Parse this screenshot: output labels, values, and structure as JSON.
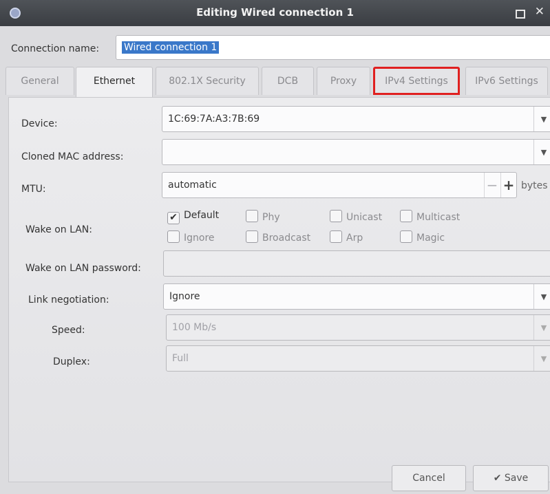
{
  "window": {
    "title": "Editing Wired connection 1",
    "close_glyph": "✕"
  },
  "connection_name": {
    "label": "Connection name:",
    "value": "Wired connection 1"
  },
  "tabs": [
    {
      "label": "General",
      "active": false
    },
    {
      "label": "Ethernet",
      "active": true
    },
    {
      "label": "802.1X Security",
      "active": false
    },
    {
      "label": "DCB",
      "active": false
    },
    {
      "label": "Proxy",
      "active": false
    },
    {
      "label": "IPv4 Settings",
      "active": false,
      "highlighted": true
    },
    {
      "label": "IPv6 Settings",
      "active": false
    }
  ],
  "ethernet": {
    "device": {
      "label": "Device:",
      "value": "1C:69:7A:A3:7B:69"
    },
    "cloned_mac": {
      "label": "Cloned MAC address:",
      "value": ""
    },
    "mtu": {
      "label": "MTU:",
      "value": "automatic",
      "unit": "bytes",
      "minus": "−",
      "plus": "+"
    },
    "wake_on_lan": {
      "label": "Wake on LAN:",
      "options": [
        {
          "label": "Default",
          "checked": true
        },
        {
          "label": "Phy",
          "checked": false
        },
        {
          "label": "Unicast",
          "checked": false
        },
        {
          "label": "Multicast",
          "checked": false
        },
        {
          "label": "Ignore",
          "checked": false
        },
        {
          "label": "Broadcast",
          "checked": false
        },
        {
          "label": "Arp",
          "checked": false
        },
        {
          "label": "Magic",
          "checked": false
        }
      ]
    },
    "wol_password": {
      "label": "Wake on LAN password:",
      "value": ""
    },
    "link_negotiation": {
      "label": "Link negotiation:",
      "value": "Ignore"
    },
    "speed": {
      "label": "Speed:",
      "value": "100 Mb/s"
    },
    "duplex": {
      "label": "Duplex:",
      "value": "Full"
    }
  },
  "buttons": {
    "cancel": "Cancel",
    "save": "✔ Save"
  },
  "colors": {
    "highlight_border": "#e02020",
    "selection": "#3a78c9"
  },
  "icons": {
    "dropdown": "▼",
    "check": "✔"
  }
}
